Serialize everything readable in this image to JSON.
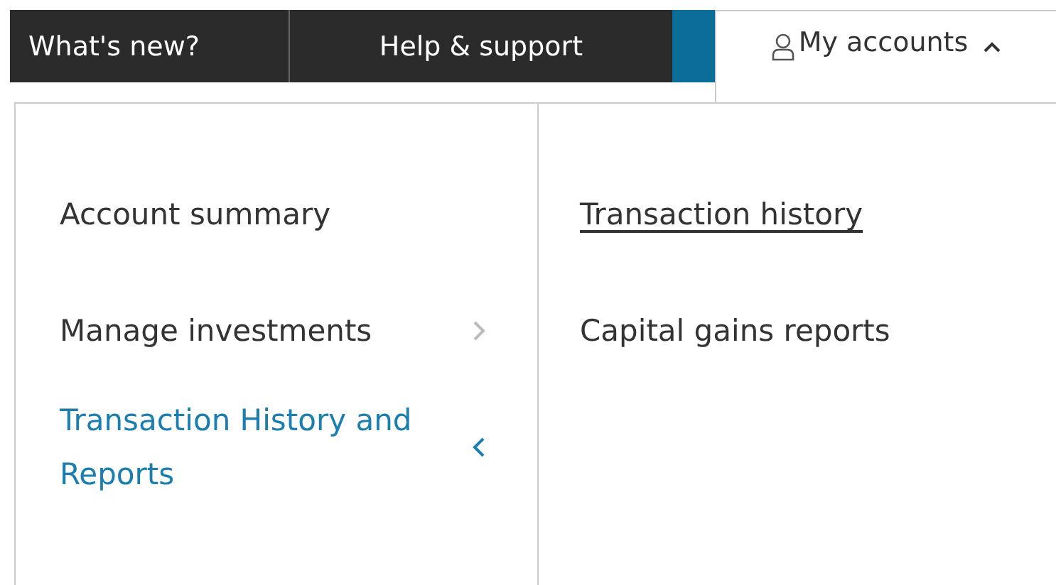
{
  "nav": {
    "links": [
      {
        "label": "What's new?"
      },
      {
        "label": "Help & support"
      }
    ],
    "account_tab": {
      "label": "My accounts",
      "expanded": true
    }
  },
  "menu": {
    "items": [
      {
        "label": "Account summary",
        "selected": false,
        "has_submenu": false
      },
      {
        "label": "Manage investments",
        "selected": false,
        "has_submenu": true
      },
      {
        "label": "Transaction History and Reports",
        "selected": true,
        "has_submenu": true
      }
    ],
    "submenu": [
      {
        "label": "Transaction history",
        "selected": true
      },
      {
        "label": "Capital gains reports",
        "selected": false
      }
    ]
  }
}
